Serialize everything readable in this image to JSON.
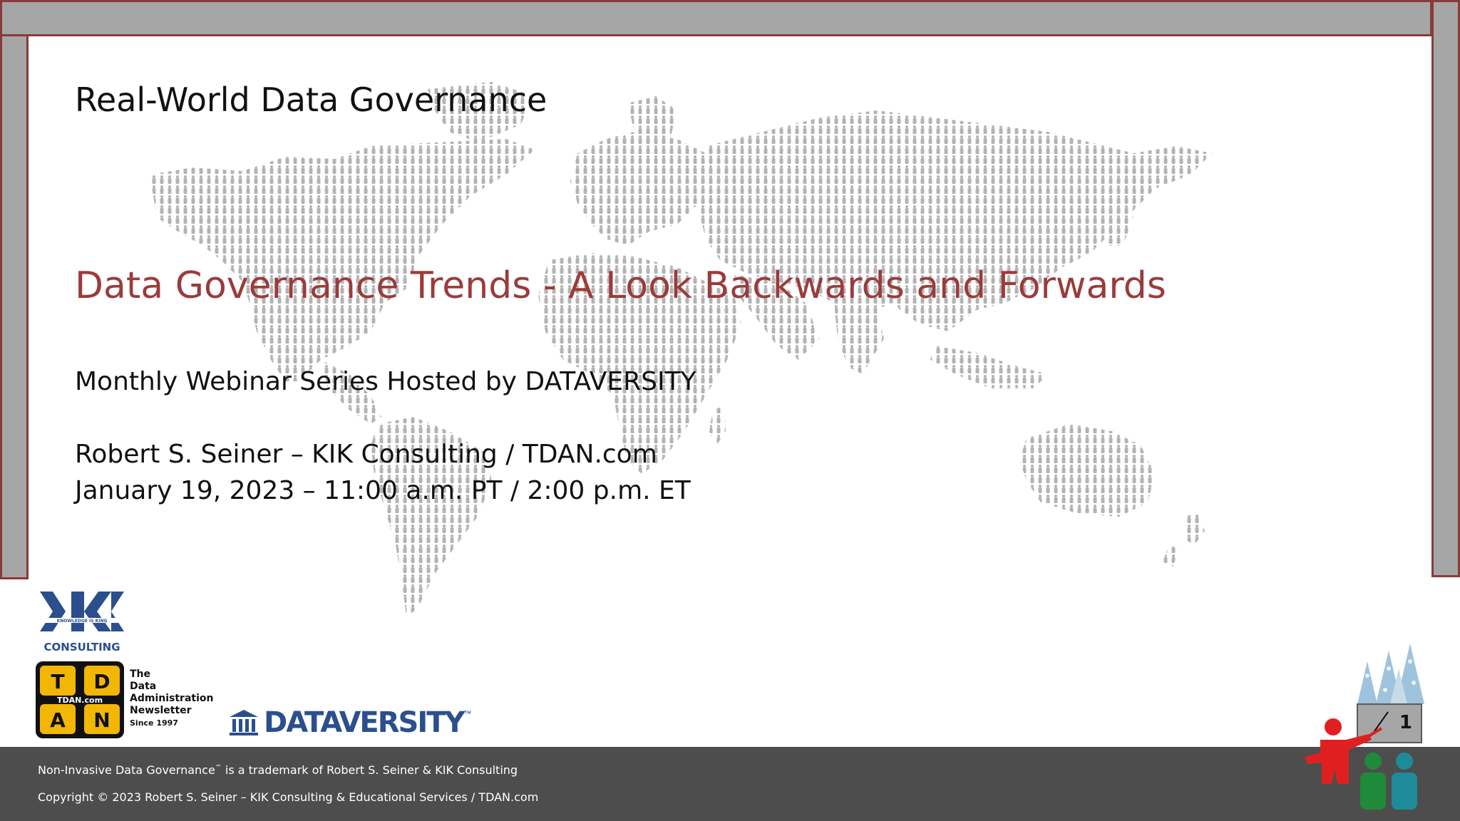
{
  "slide": {
    "header": "Real-World Data Governance",
    "title": "Data Governance Trends - A Look Backwards and Forwards",
    "subtitle": "Monthly Webinar Series Hosted by DATAVERSITY",
    "presenter": "Robert S. Seiner – KIK Consulting / TDAN.com",
    "date": "January 19, 2023 – 11:00 a.m. PT / 2:00 p.m. ET"
  },
  "logos": {
    "kik": {
      "tagline": "KNOWLEDGE IS KING",
      "name": "CONSULTING",
      "icon": "kik-logo-icon"
    },
    "tdan": {
      "tiles": [
        "T",
        "D",
        "A",
        "N"
      ],
      "center": "TDAN.com",
      "caption_1": "The",
      "caption_2": "Data",
      "caption_3": "Administration",
      "caption_4": "Newsletter",
      "caption_5": "Since 1997",
      "icon": "tdan-logo-icon"
    },
    "dataversity": {
      "name": "DATAVERSITY",
      "tm": "™",
      "icon": "building-icon"
    }
  },
  "footer": {
    "trademark_pre": "Non-Invasive Data Governance",
    "trademark_sup": "™",
    "trademark_post": " is a trademark of Robert S. Seiner & KIK Consulting",
    "copyright": "Copyright © 2023 Robert S. Seiner – KIK Consulting & Educational Services / TDAN.com"
  },
  "page": {
    "number": "1"
  },
  "colors": {
    "frame": "#a6a6a6",
    "frame_border": "#8b3a3a",
    "title": "#9b3b3b",
    "footer_bg": "#4d4d4d",
    "map_dots": "#b3b3b3",
    "tdan_tile": "#f2b705",
    "kik_blue": "#2b4f8e",
    "presenter_red": "#e02020",
    "audience_green": "#1f8a3a",
    "audience_teal": "#1f8a99"
  }
}
